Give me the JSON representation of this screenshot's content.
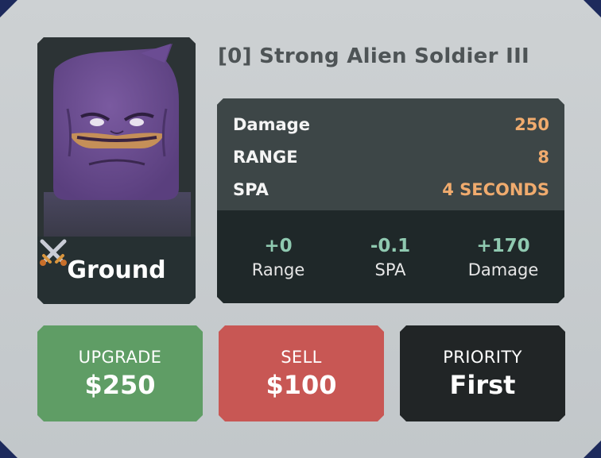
{
  "unit": {
    "name": "[0] Strong Alien Soldier III",
    "type_label": "Ground",
    "type_icon": "crossed-swords-icon",
    "portrait": "purple-alien-soldier-head"
  },
  "stats": [
    {
      "label": "Damage",
      "value": "250"
    },
    {
      "label": "RANGE",
      "value": "8"
    },
    {
      "label": "SPA",
      "value": "4 SECONDS"
    }
  ],
  "upgrade_deltas": [
    {
      "value": "+0",
      "label": "Range"
    },
    {
      "value": "-0.1",
      "label": "SPA"
    },
    {
      "value": "+170",
      "label": "Damage"
    }
  ],
  "actions": {
    "upgrade": {
      "title": "UPGRADE",
      "value": "$250",
      "color": "#5f9d65"
    },
    "sell": {
      "title": "SELL",
      "value": "$100",
      "color": "#c85754"
    },
    "priority": {
      "title": "PRIORITY",
      "value": "First",
      "color": "#212526"
    }
  },
  "colors": {
    "stat_value": "#f0ab6e",
    "delta_value": "#8fc9b0",
    "panel_background": "#c8ccce"
  }
}
